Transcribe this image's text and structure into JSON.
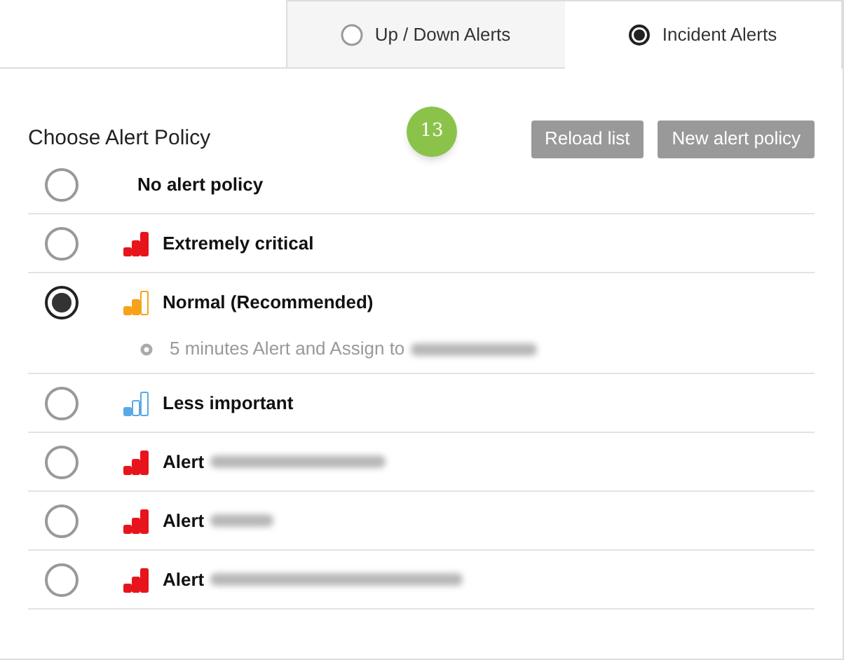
{
  "tabs": [
    {
      "label": "Up / Down Alerts",
      "selected": false
    },
    {
      "label": "Incident Alerts",
      "selected": true
    }
  ],
  "heading": "Choose Alert Policy",
  "badge": "13",
  "buttons": [
    "Reload list",
    "New alert policy"
  ],
  "policies": [
    {
      "label": "No alert policy",
      "selected": false
    },
    {
      "label": "Extremely critical",
      "selected": false,
      "kind": "high",
      "color": "#e8141c"
    },
    {
      "label": "Normal (Recommended)",
      "selected": true,
      "kind": "medium",
      "color": "#f7a21b",
      "details": [
        {
          "text": "5 minutes Alert and Assign to",
          "redacted": true
        }
      ]
    },
    {
      "label": "Less important",
      "selected": false,
      "kind": "low",
      "color": "#5aa9e6"
    },
    {
      "label": "Alert",
      "selected": false,
      "kind": "high",
      "color": "#e8141c",
      "redacted": true
    },
    {
      "label": "Alert",
      "selected": false,
      "kind": "high",
      "color": "#e8141c",
      "redacted": true
    },
    {
      "label": "Alert",
      "selected": false,
      "kind": "high",
      "color": "#e8141c",
      "redacted": true
    }
  ]
}
